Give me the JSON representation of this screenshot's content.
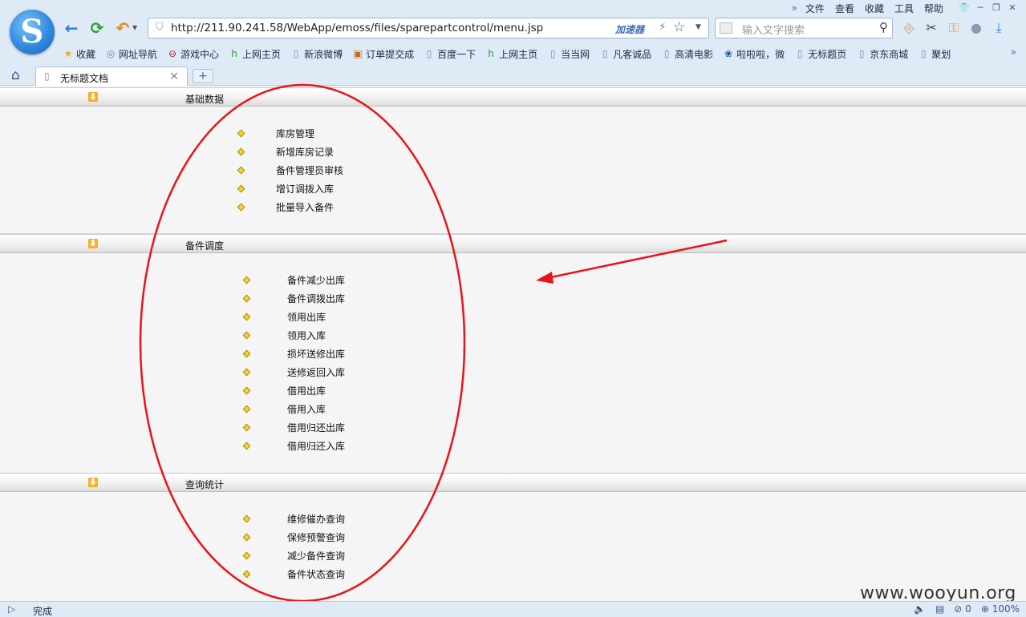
{
  "browser": {
    "menu": [
      "文件",
      "查看",
      "收藏",
      "工具",
      "帮助"
    ],
    "url": "http://211.90.241.58/WebApp/emoss/files/sparepartcontrol/menu.jsp",
    "accelerator_label": "加速器",
    "search_placeholder": "输入文字搜索",
    "bookmarks": [
      "收藏",
      "网址导航",
      "游戏中心",
      "上网主页",
      "新浪微博",
      "订单提交成",
      "百度一下",
      "上网主页",
      "当当网",
      "凡客诚品",
      "高清电影",
      "啦啦啦，微",
      "无标题页",
      "京东商城",
      "聚划"
    ],
    "tab_title": "无标题文档",
    "status_text": "完成",
    "status_count": "0",
    "zoom": "100%"
  },
  "sections": [
    {
      "title": "基础数据",
      "items": [
        "库房管理",
        "新增库房记录",
        "备件管理员审核",
        "增订调拨入库",
        "批量导入备件"
      ]
    },
    {
      "title": "备件调度",
      "items": [
        "备件减少出库",
        "备件调拨出库",
        "领用出库",
        "领用入库",
        "损坏送修出库",
        "送修返回入库",
        "借用出库",
        "借用入库",
        "借用归还出库",
        "借用归还入库"
      ]
    },
    {
      "title": "查询统计",
      "items": [
        "维修催办查询",
        "保修预警查询",
        "减少备件查询",
        "备件状态查询"
      ]
    }
  ],
  "watermark": "www.wooyun.org",
  "colors": {
    "chrome_bg": "#dfeaf7",
    "annotation": "#e8141a",
    "bullet": "#f1d236"
  }
}
